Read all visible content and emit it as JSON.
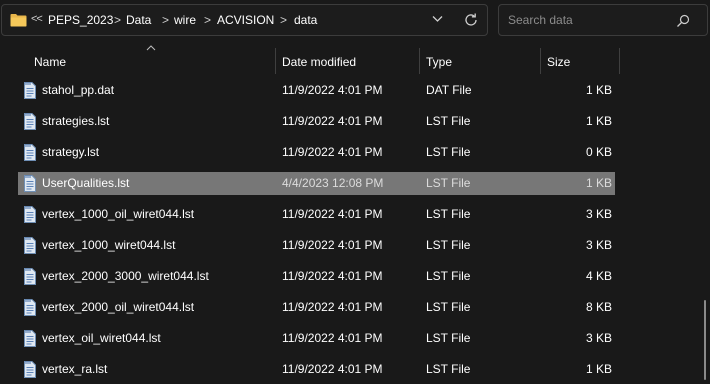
{
  "address_bar": {
    "overflow": "<<",
    "crumbs": [
      "PEPS_2023",
      "Data",
      "wire",
      "ACVISION",
      "data"
    ],
    "separator": ">"
  },
  "search": {
    "placeholder": "Search data"
  },
  "columns": {
    "name": "Name",
    "date": "Date modified",
    "type": "Type",
    "size": "Size"
  },
  "sort": {
    "column": "name",
    "direction": "ascending"
  },
  "files": [
    {
      "name": "stahol_pp.dat",
      "date": "11/9/2022 4:01 PM",
      "type": "DAT File",
      "size": "1 KB"
    },
    {
      "name": "strategies.lst",
      "date": "11/9/2022 4:01 PM",
      "type": "LST File",
      "size": "1 KB"
    },
    {
      "name": "strategy.lst",
      "date": "11/9/2022 4:01 PM",
      "type": "LST File",
      "size": "0 KB"
    },
    {
      "name": "UserQualities.lst",
      "date": "4/4/2023 12:08 PM",
      "type": "LST File",
      "size": "1 KB"
    },
    {
      "name": "vertex_1000_oil_wiret044.lst",
      "date": "11/9/2022 4:01 PM",
      "type": "LST File",
      "size": "3 KB"
    },
    {
      "name": "vertex_1000_wiret044.lst",
      "date": "11/9/2022 4:01 PM",
      "type": "LST File",
      "size": "3 KB"
    },
    {
      "name": "vertex_2000_3000_wiret044.lst",
      "date": "11/9/2022 4:01 PM",
      "type": "LST File",
      "size": "4 KB"
    },
    {
      "name": "vertex_2000_oil_wiret044.lst",
      "date": "11/9/2022 4:01 PM",
      "type": "LST File",
      "size": "8 KB"
    },
    {
      "name": "vertex_oil_wiret044.lst",
      "date": "11/9/2022 4:01 PM",
      "type": "LST File",
      "size": "3 KB"
    },
    {
      "name": "vertex_ra.lst",
      "date": "11/9/2022 4:01 PM",
      "type": "LST File",
      "size": "1 KB"
    }
  ],
  "selected_index": 3,
  "colors": {
    "background": "#191919",
    "selected_row": "#777777",
    "border": "#3c3c3c",
    "folder": "#e8b64b"
  }
}
